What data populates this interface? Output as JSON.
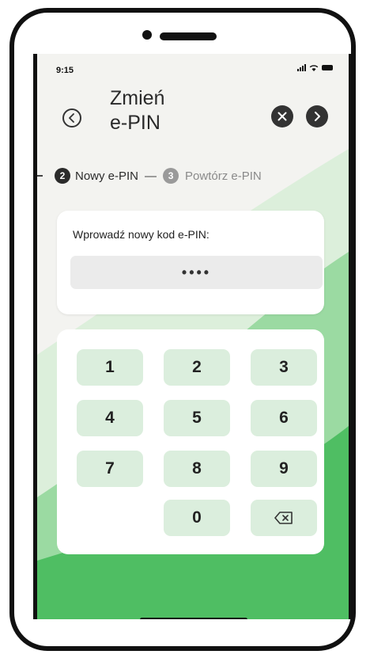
{
  "status_bar": {
    "time": "9:15"
  },
  "header": {
    "title_line1": "Zmień",
    "title_line2": "e-PIN"
  },
  "steps": {
    "current_number": "2",
    "current_label": "Nowy e-PIN",
    "separator": "—",
    "next_number": "3",
    "next_label": "Powtórz e-PIN"
  },
  "pin_entry": {
    "prompt": "Wprowadź nowy kod e-PIN:",
    "masked_value": "••••"
  },
  "keypad": {
    "keys": [
      "1",
      "2",
      "3",
      "4",
      "5",
      "6",
      "7",
      "8",
      "9",
      "0"
    ]
  },
  "colors": {
    "accent_green": "#55c26a",
    "light_green": "#dbeedd",
    "dark_icon": "#333333",
    "step_current": "#2b2b2b",
    "step_next": "#9a9a9a"
  },
  "icons": {
    "back": "chevron-left-icon",
    "close": "close-icon",
    "next": "chevron-right-icon",
    "backspace": "backspace-icon"
  }
}
